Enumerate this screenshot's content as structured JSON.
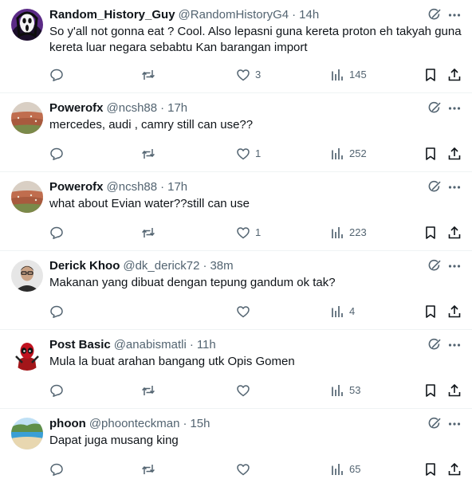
{
  "colors": {
    "text": "#0f1419",
    "secondary": "#536471",
    "divider": "#eff3f4"
  },
  "tweets": [
    {
      "name": "Random_History_Guy",
      "handle": "@RandomHistoryG4",
      "separator": "·",
      "time": "14h",
      "text": "So y'all not gonna eat ? Cool. Also lepasni guna kereta proton eh takyah guna kereta luar negara sebabtu Kan barangan import",
      "replies": "",
      "retweets": "",
      "likes": "3",
      "views": "145",
      "avatar_icon": "ghostface-avatar-icon"
    },
    {
      "name": "Powerofx",
      "handle": "@ncsh88",
      "separator": "·",
      "time": "17h",
      "text": "mercedes, audi , camry still can use??",
      "replies": "",
      "retweets": "",
      "likes": "1",
      "views": "252",
      "avatar_icon": "cityscape-avatar-icon"
    },
    {
      "name": "Powerofx",
      "handle": "@ncsh88",
      "separator": "·",
      "time": "17h",
      "text": "what about Evian water??still can use",
      "replies": "",
      "retweets": "",
      "likes": "1",
      "views": "223",
      "avatar_icon": "cityscape-avatar-icon"
    },
    {
      "name": "Derick Khoo",
      "handle": "@dk_derick72",
      "separator": "·",
      "time": "38m",
      "text": "Makanan yang dibuat dengan tepung gandum ok tak?",
      "replies": "",
      "retweets": "",
      "likes": "",
      "views": "4",
      "avatar_icon": "portrait-avatar-icon"
    },
    {
      "name": "Post Basic",
      "handle": "@anabismatli",
      "separator": "·",
      "time": "11h",
      "text": "Mula la buat arahan bangang utk Opis Gomen",
      "replies": "",
      "retweets": "",
      "likes": "",
      "views": "53",
      "avatar_icon": "deadpool-avatar-icon"
    },
    {
      "name": "phoon",
      "handle": "@phoonteckman",
      "separator": "·",
      "time": "15h",
      "text": "Dapat juga musang king",
      "replies": "",
      "retweets": "",
      "likes": "",
      "views": "65",
      "avatar_icon": "beach-avatar-icon"
    }
  ]
}
